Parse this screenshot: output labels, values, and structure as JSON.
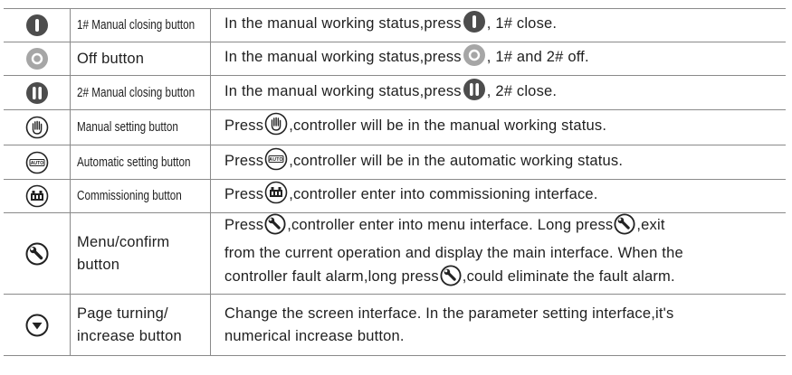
{
  "rows": [
    {
      "icon": "manual-close-1-icon",
      "name": "1# Manual closing button",
      "desc_a": "In the manual working status,press",
      "desc_b": ", 1# close."
    },
    {
      "icon": "off-icon",
      "name": "Off button",
      "desc_a": "In the manual working status,press",
      "desc_b": ", 1# and 2# off."
    },
    {
      "icon": "manual-close-2-icon",
      "name": "2# Manual closing button",
      "desc_a": "In the manual working status,press",
      "desc_b": ", 2# close."
    },
    {
      "icon": "hand-icon",
      "name": "Manual setting button",
      "desc_a": "Press",
      "desc_b": ",controller will be in the manual working status."
    },
    {
      "icon": "auto-icon",
      "name": "Automatic setting button",
      "desc_a": "Press",
      "desc_b": ",controller will be in the automatic working status.",
      "icon_text": "AUTO"
    },
    {
      "icon": "commission-icon",
      "name": "Commissioning button",
      "desc_a": "Press",
      "desc_b": ",controller enter into commissioning interface."
    },
    {
      "icon": "wrench-icon",
      "name_l1": "Menu/confirm",
      "name_l2": "button",
      "desc_1a": "Press",
      "desc_1b": ",controller enter into menu interface. Long press",
      "desc_1c": ",exit",
      "desc_2": "from the current operation and display the main interface. When the",
      "desc_3a": "controller fault alarm,long press",
      "desc_3b": ",could eliminate the fault alarm."
    },
    {
      "icon": "down-arrow-icon",
      "name_l1": "Page turning/",
      "name_l2": "increase button",
      "desc_1": "Change the screen interface. In the parameter setting interface,it's",
      "desc_2": "numerical increase button."
    }
  ]
}
